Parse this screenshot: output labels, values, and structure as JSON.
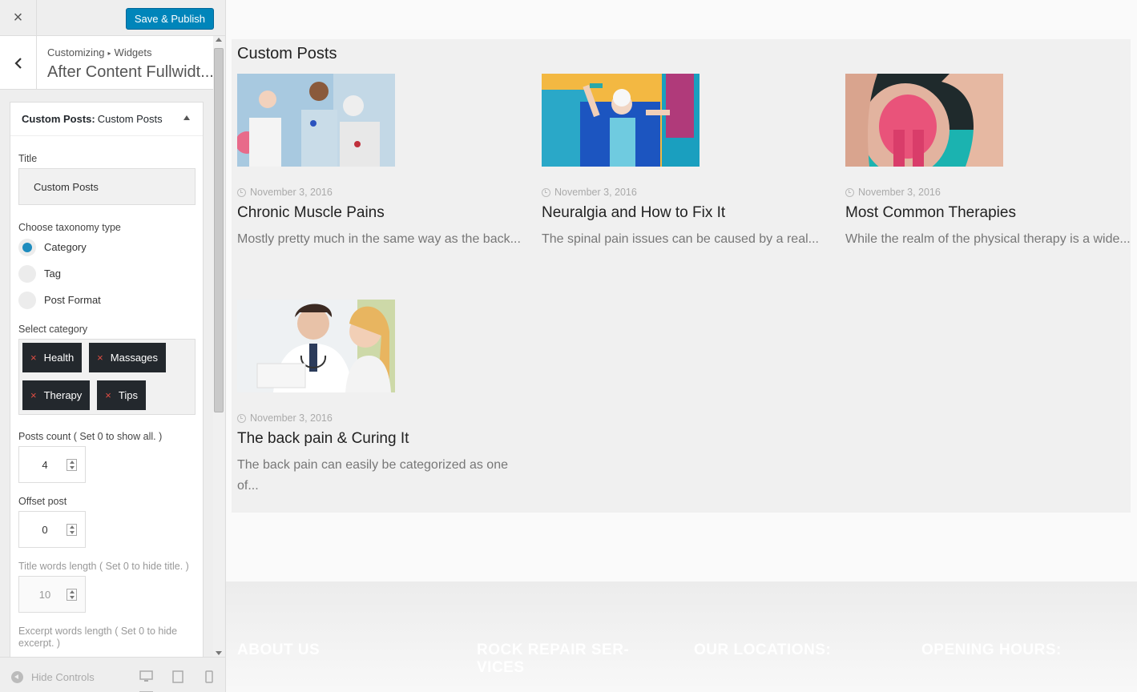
{
  "sidebar": {
    "close_icon": "×",
    "publish_label": "Save & Publish",
    "breadcrumb": {
      "root": "Customizing",
      "sep": "▸",
      "current": "Widgets"
    },
    "section_title": "After Content Fullwidt...",
    "widget": {
      "title_bold": "Custom Posts:",
      "title_sub": "Custom Posts",
      "title_label": "Title",
      "title_value": "Custom Posts",
      "taxonomy_label": "Choose taxonomy type",
      "taxonomy_options": [
        "Category",
        "Tag",
        "Post Format"
      ],
      "taxonomy_selected": "Category",
      "category_label": "Select category",
      "categories": [
        "Health",
        "Massages",
        "Therapy",
        "Tips"
      ],
      "posts_count_label": "Posts count ( Set 0 to show all. )",
      "posts_count_value": "4",
      "offset_label": "Offset post",
      "offset_value": "0",
      "title_words_label": "Title words length ( Set 0 to hide title. )",
      "title_words_value": "10",
      "excerpt_words_label": "Excerpt words length ( Set 0 to hide excerpt. )"
    },
    "footer": {
      "hide_controls": "Hide Controls"
    }
  },
  "preview": {
    "heading": "Custom Posts",
    "posts": [
      {
        "date": "November 3, 2016",
        "title": "Chronic Muscle Pains",
        "excerpt": "Mostly pretty much in the same way as the back..."
      },
      {
        "date": "November 3, 2016",
        "title": "Neuralgia and How to Fix It",
        "excerpt": "The spinal pain issues can be caused by a real..."
      },
      {
        "date": "November 3, 2016",
        "title": "Most Common Therapies",
        "excerpt": "While the realm of the physical therapy is a wide..."
      },
      {
        "date": "November 3, 2016",
        "title": "The back pain & Curing It",
        "excerpt": "The back pain can easily be categorized as one of..."
      }
    ],
    "footer_headings": [
      "ABOUT US",
      "ROCK REPAIR SER-VICES",
      "OUR LOCATIONS:",
      "OPENING HOURS:"
    ]
  },
  "colors": {
    "accent": "#0085ba",
    "tag_bg": "#23282d",
    "tag_x": "#e14d43",
    "radio": "#1e8cbe"
  }
}
